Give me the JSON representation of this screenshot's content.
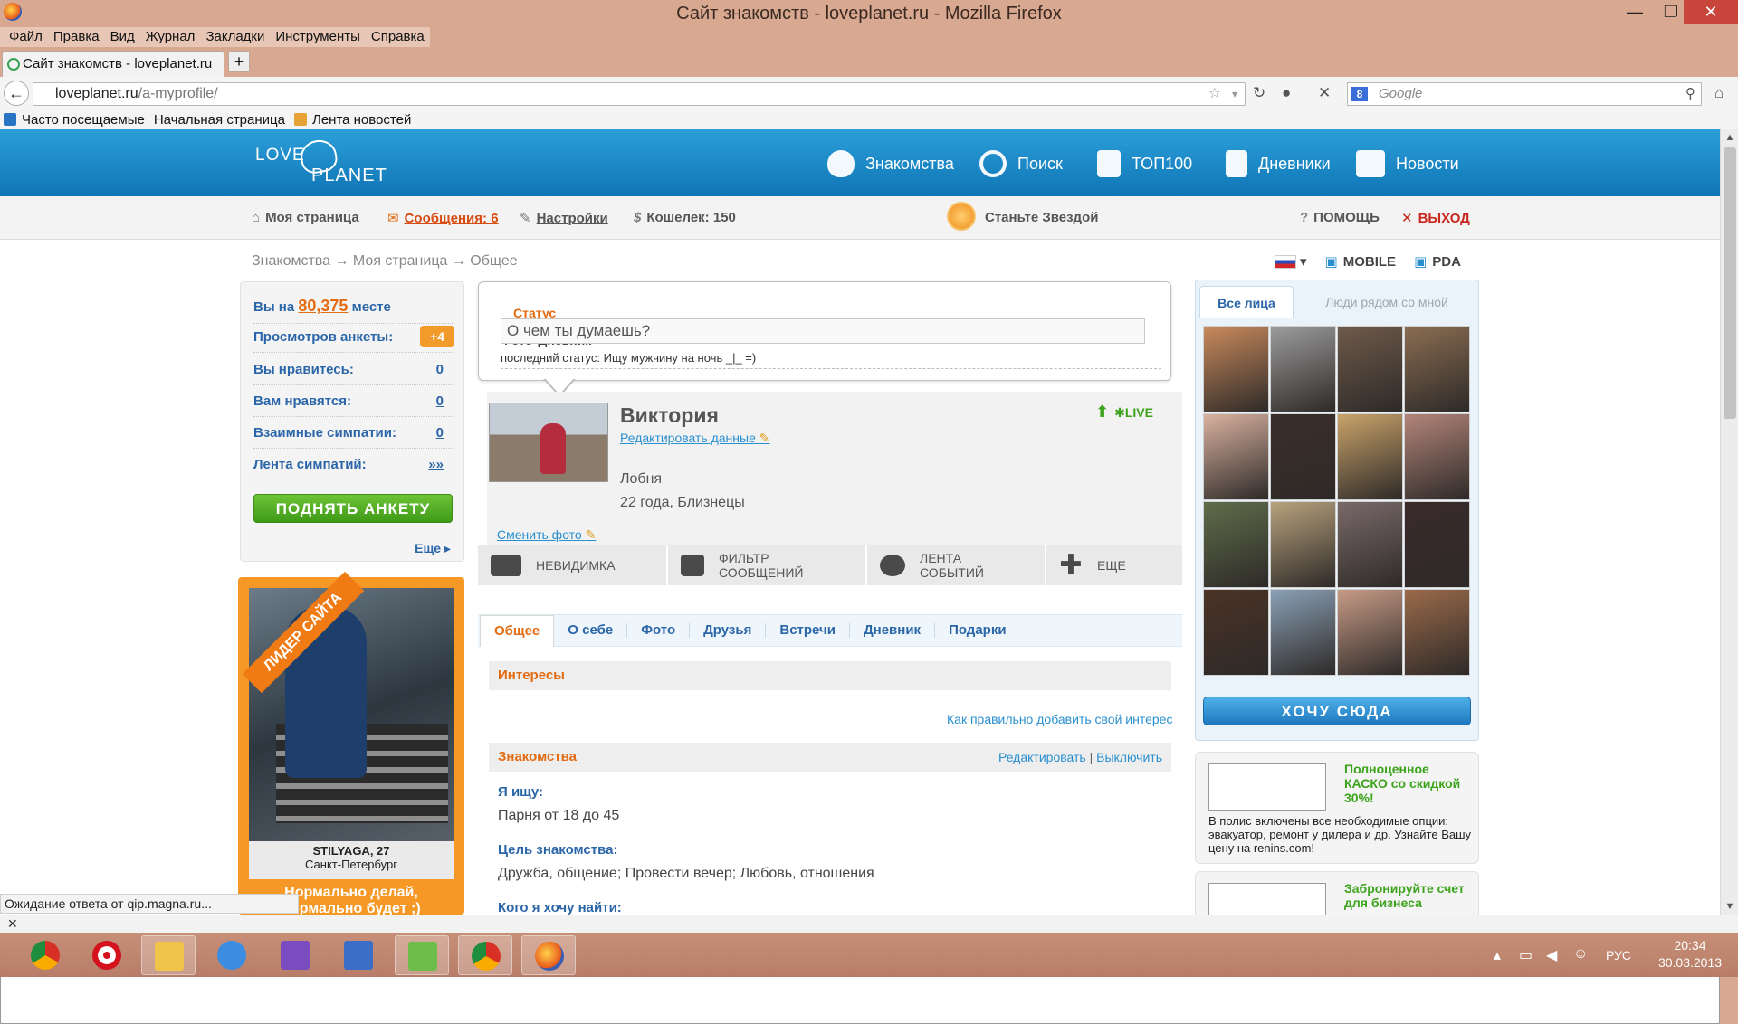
{
  "window": {
    "title": "Сайт знакомств - loveplanet.ru - Mozilla Firefox",
    "min": "—",
    "max": "❐",
    "close": "✕"
  },
  "menu": [
    "Файл",
    "Правка",
    "Вид",
    "Журнал",
    "Закладки",
    "Инструменты",
    "Справка"
  ],
  "tab": {
    "label": "Сайт знакомств - loveplanet.ru",
    "new": "+"
  },
  "nav": {
    "back": "←",
    "url_host": "loveplanet.ru",
    "url_path": "/a-myprofile/",
    "search_placeholder": "Google",
    "search_engine": "8"
  },
  "bookmarks": [
    "Часто посещаемые",
    "Начальная страница",
    "Лента новостей"
  ],
  "site": {
    "logo_top": "LOVE",
    "logo_bottom": "PLANET",
    "topnav": [
      "Знакомства",
      "Поиск",
      "ТОП100",
      "Дневники",
      "Новости"
    ],
    "subnav": {
      "my_page": "Моя страница",
      "messages": "Сообщения: 6",
      "settings": "Настройки",
      "wallet": "Кошелек: 150",
      "star": "Станьте Звездой",
      "help": "ПОМОЩЬ",
      "exit": "ВЫХОД",
      "help_icon": "?",
      "exit_icon": "✕"
    },
    "crumbs": "Знакомства → Моя страница → Общее",
    "lang": {
      "mobile": "MOBILE",
      "pda": "PDA"
    }
  },
  "stats": {
    "rank_prefix": "Вы на",
    "rank_value": "80,375",
    "rank_suffix": "месте",
    "rows": [
      {
        "label": "Просмотров анкеты:",
        "value": "+4"
      },
      {
        "label": "Вы нравитесь:",
        "value": "0"
      },
      {
        "label": "Вам нравятся:",
        "value": "0"
      },
      {
        "label": "Взаимные симпатии:",
        "value": "0"
      },
      {
        "label": "Лента симпатий:",
        "value": "»»"
      }
    ],
    "raise": "ПОДНЯТЬ АНКЕТУ",
    "more": "Еще ▸"
  },
  "leader": {
    "ribbon": "ЛИДЕР САЙТА",
    "name": "STILYAGA, 27",
    "city": "Санкт-Петербург",
    "slogan_1": "Нормально делай,",
    "slogan_2": "нормально будет ;)"
  },
  "status": {
    "tabs": [
      "Статус",
      "Фото",
      "Дневник"
    ],
    "placeholder": "О чем ты думаешь?",
    "last": "последний статус: Ищу мужчину на ночь _|_ =)"
  },
  "profile": {
    "name": "Виктория",
    "edit": "Редактировать данные",
    "city": "Лобня",
    "age": "22 года, Близнецы",
    "change_photo": "Сменить фото",
    "live": "LIVE"
  },
  "actions": [
    "НЕВИДИМКА",
    "ФИЛЬТР СООБЩЕНИЙ",
    "ЛЕНТА СОБЫТИЙ",
    "ЕЩЕ"
  ],
  "ptabs": [
    "Общее",
    "О себе",
    "Фото",
    "Друзья",
    "Встречи",
    "Дневник",
    "Подарки"
  ],
  "interests": {
    "title": "Интересы",
    "hint": "Как правильно добавить свой интерес"
  },
  "dating": {
    "title": "Знакомства",
    "edit": "Редактировать",
    "sep": "|",
    "off": "Выключить",
    "seek_label": "Я ищу:",
    "seek_value": "Парня от 18 до 45",
    "goal_label": "Цель знакомства:",
    "goal_value": "Дружба, общение; Провести вечер; Любовь, отношения",
    "who_label": "Кого я хочу найти:"
  },
  "faces": {
    "tab_all": "Все лица",
    "tab_near": "Люди рядом со мной",
    "want": "ХОЧУ СЮДА",
    "colors": [
      "#c98a5c",
      "#9c9c9c",
      "#6e5a4a",
      "#8a6d52",
      "#d9b2a0",
      "#3b2e2a",
      "#c9a36a",
      "#b3857a",
      "#5f6d4a",
      "#b8a27d",
      "#7a6a6a",
      "#3a2a2a",
      "#4a3326",
      "#8aa0b6",
      "#c79b86",
      "#9a6a4a"
    ]
  },
  "ads": [
    {
      "title": "Полноценное КАСКО со скидкой 30%!",
      "desc": "В полис включены все необходимые опции: эвакуатор, ремонт у дилера и др. Узнайте Вашу цену на renins.com!"
    },
    {
      "title": "Забронируйте счет для бизнеса",
      "desc": ""
    }
  ],
  "statusbar": "Ожидание ответа от qip.magna.ru...",
  "tray": {
    "lang": "РУС",
    "time": "20:34",
    "date": "30.03.2013"
  }
}
